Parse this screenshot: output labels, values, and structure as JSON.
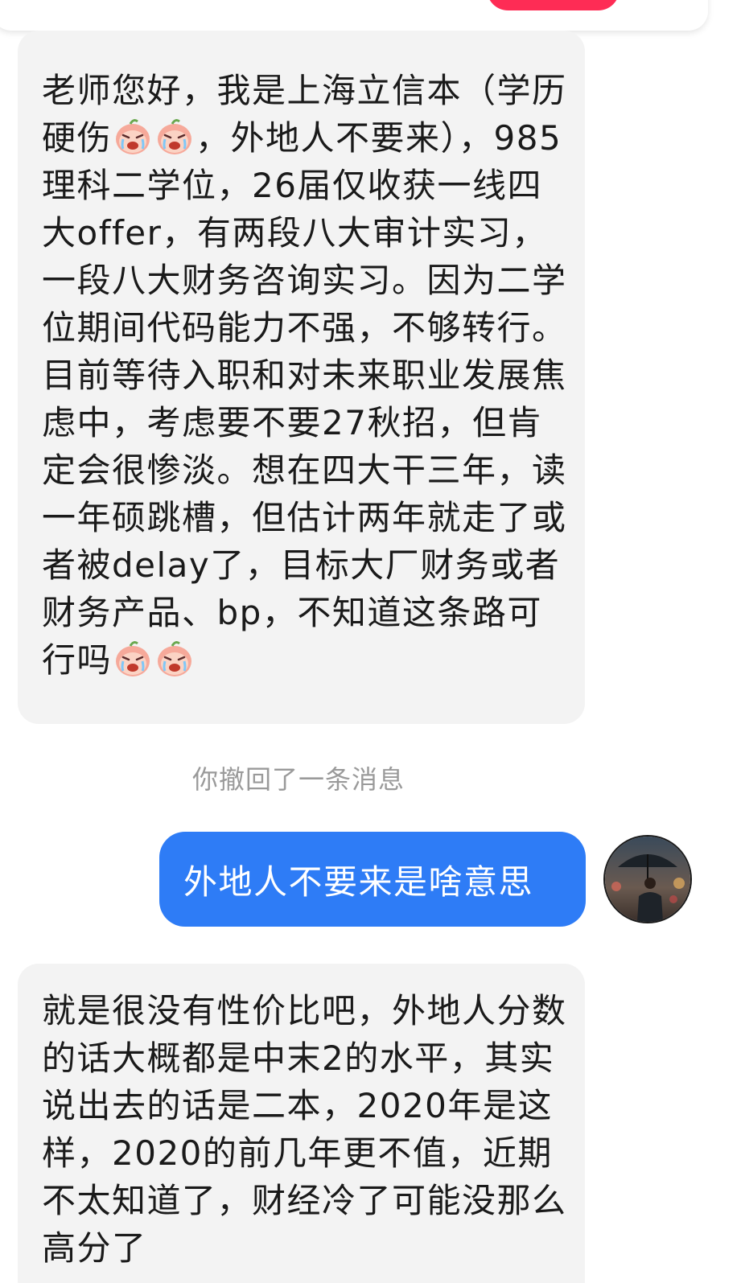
{
  "conversation": {
    "message_1": {
      "parts": [
        "老师您好，我是上海立信本（学历硬伤",
        "，外地人不要来），985理科二学位，26届仅收获一线四大offer，有两段八大审计实习，一段八大财务咨询实习。因为二学位期间代码能力不强，不够转行。目前等待入职和对未来职业发展焦虑中，考虑要不要27秋招，但肯定会很惨淡。想在四大干三年，读一年硕跳槽，但估计两年就走了或者被delay了，目标大厂财务或者财务产品、bp，不知道这条路可行吗"
      ],
      "emoji_icon": "crying-peach-emoji"
    },
    "system_notice": "你撤回了一条消息",
    "message_2": {
      "text": "外地人不要来是啥意思"
    },
    "message_3": {
      "text": "就是很没有性价比吧，外地人分数的话大概都是中末2的水平，其实说出去的话是二本，2020年是这样，2020的前几年更不值，近期不太知道了，财经冷了可能没那么高分了"
    },
    "colors": {
      "incoming_bubble": "#f3f3f3",
      "outgoing_bubble": "#2e7cf6",
      "accent_pill": "#fe2c55"
    }
  }
}
